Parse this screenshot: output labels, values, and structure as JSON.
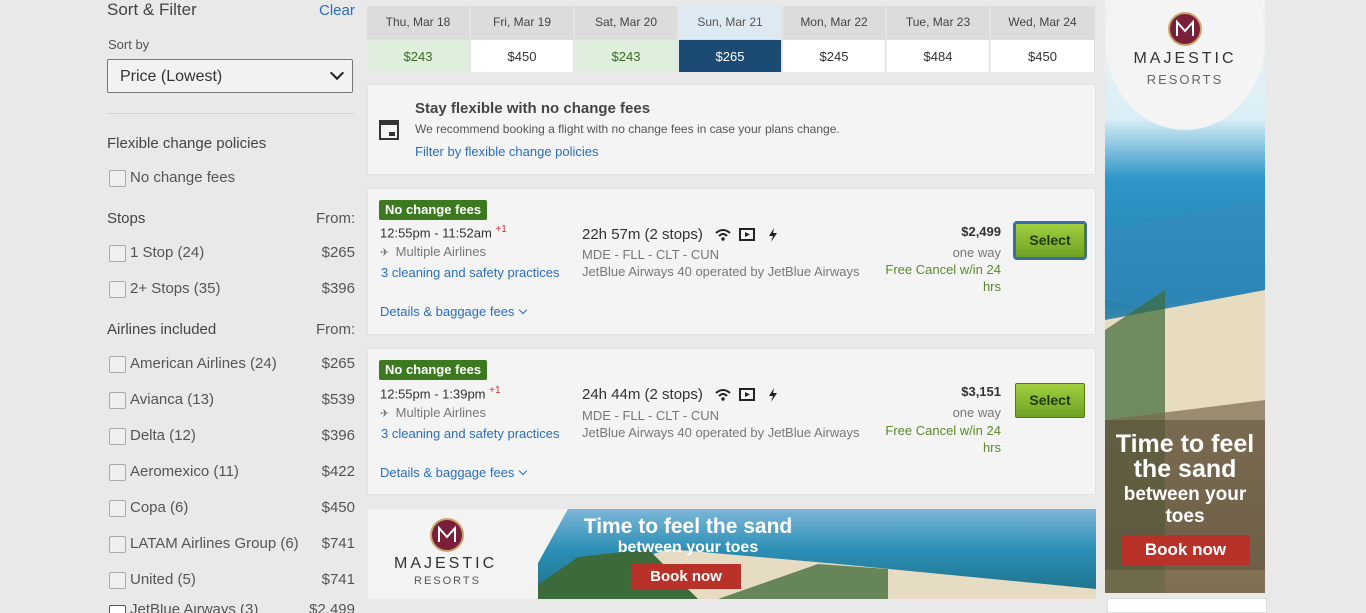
{
  "sidebar": {
    "title": "Sort & Filter",
    "clear": "Clear",
    "sort_by_label": "Sort by",
    "sort_value": "Price (Lowest)",
    "flexible_heading": "Flexible change policies",
    "no_change_fees": "No change fees",
    "stops_heading": "Stops",
    "from_label": "From:",
    "stops": [
      {
        "label": "1 Stop (24)",
        "price": "$265"
      },
      {
        "label": "2+ Stops (35)",
        "price": "$396"
      }
    ],
    "airlines_heading": "Airlines included",
    "airlines": [
      {
        "label": "American Airlines (24)",
        "price": "$265"
      },
      {
        "label": "Avianca (13)",
        "price": "$539"
      },
      {
        "label": "Delta (12)",
        "price": "$396"
      },
      {
        "label": "Aeromexico (11)",
        "price": "$422"
      },
      {
        "label": "Copa (6)",
        "price": "$450"
      },
      {
        "label": "LATAM Airlines Group (6)",
        "price": "$741"
      },
      {
        "label": "United (5)",
        "price": "$741"
      },
      {
        "label": "JetBlue Airways (3)",
        "price": "$2,499"
      }
    ]
  },
  "dates": [
    {
      "day": "Thu, Mar 18",
      "price": "$243",
      "low": true
    },
    {
      "day": "Fri, Mar 19",
      "price": "$450",
      "low": false
    },
    {
      "day": "Sat, Mar 20",
      "price": "$243",
      "low": true
    },
    {
      "day": "Sun, Mar 21",
      "price": "$265",
      "low": false,
      "selected": true
    },
    {
      "day": "Mon, Mar 22",
      "price": "$245",
      "low": false
    },
    {
      "day": "Tue, Mar 23",
      "price": "$484",
      "low": false
    },
    {
      "day": "Wed, Mar 24",
      "price": "$450",
      "low": false
    }
  ],
  "flex_banner": {
    "title": "Stay flexible with no change fees",
    "text": "We recommend booking a flight with no change fees in case your plans change.",
    "link": "Filter by flexible change policies"
  },
  "flights": [
    {
      "badge": "No change fees",
      "times": "12:55pm - 11:52am",
      "plus_days": "+1",
      "airline": "Multiple Airlines",
      "safety": "3 cleaning and safety practices",
      "duration": "22h 57m (2 stops)",
      "route": "MDE - FLL - CLT - CUN",
      "operated": "JetBlue Airways 40 operated by JetBlue Airways",
      "price": "$2,499",
      "price_type": "one way",
      "cancel": "Free Cancel w/in 24 hrs",
      "select": "Select",
      "details": "Details & baggage fees"
    },
    {
      "badge": "No change fees",
      "times": "12:55pm - 1:39pm",
      "plus_days": "+1",
      "airline": "Multiple Airlines",
      "safety": "3 cleaning and safety practices",
      "duration": "24h 44m (2 stops)",
      "route": "MDE - FLL - CLT - CUN",
      "operated": "JetBlue Airways 40 operated by JetBlue Airways",
      "price": "$3,151",
      "price_type": "one way",
      "cancel": "Free Cancel w/in 24 hrs",
      "select": "Select",
      "details": "Details & baggage fees"
    }
  ],
  "ads": {
    "brand": "MAJESTIC",
    "brand_sub": "RESORTS",
    "bottom_line1": "Time to feel the sand",
    "bottom_line2": "between your toes",
    "right_line1": "Time to feel",
    "right_line2": "the sand",
    "right_line3": "between your",
    "right_line4": "toes",
    "cta": "Book now"
  },
  "colors": {
    "accent_blue": "#1b4a73",
    "link": "#2a6ebb",
    "green_badge": "#3d7a1f",
    "select_green": "#8cbf32",
    "ad_red": "#b8322a",
    "brand_maroon": "#7b1e3a"
  }
}
